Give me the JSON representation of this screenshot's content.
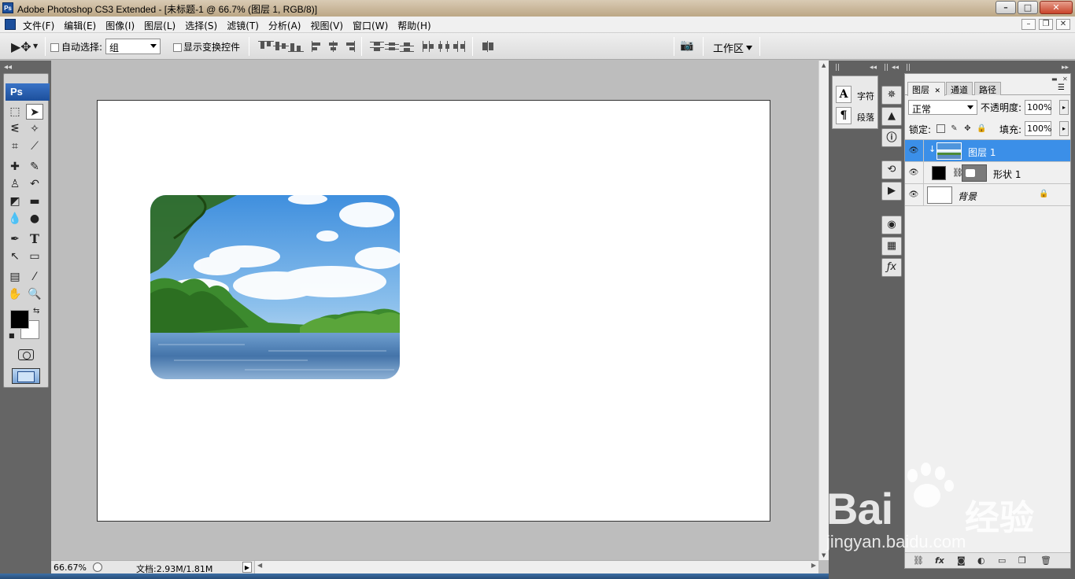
{
  "window": {
    "title": "Adobe Photoshop CS3 Extended - [未标题-1 @ 66.7% (图层 1, RGB/8)]",
    "app_badge": "Ps",
    "controls": [
      "minimize",
      "maximize",
      "close"
    ]
  },
  "menubar": {
    "items": [
      "文件(F)",
      "编辑(E)",
      "图像(I)",
      "图层(L)",
      "选择(S)",
      "滤镜(T)",
      "分析(A)",
      "视图(V)",
      "窗口(W)",
      "帮助(H)"
    ]
  },
  "options_bar": {
    "auto_select_label": "自动选择:",
    "auto_select_checked": false,
    "auto_select_value": "组",
    "show_transform_label": "显示变换控件",
    "show_transform_checked": false,
    "workspace_label": "工作区"
  },
  "toolbox": {
    "logo": "Ps",
    "foreground_color": "#000000",
    "background_color": "#ffffff",
    "tools": [
      "marquee-icon",
      "move-icon",
      "lasso-icon",
      "magic-wand-icon",
      "crop-icon",
      "slice-icon",
      "healing-brush-icon",
      "brush-icon",
      "clone-stamp-icon",
      "history-brush-icon",
      "eraser-icon",
      "gradient-icon",
      "blur-icon",
      "dodge-icon",
      "pen-icon",
      "type-icon",
      "path-select-icon",
      "shape-icon",
      "notes-icon",
      "eyedropper-icon",
      "hand-icon",
      "zoom-icon"
    ],
    "type_tool_glyph": "T"
  },
  "status_bar": {
    "zoom": "66.67%",
    "doc_info": "文档:2.93M/1.81M"
  },
  "char_panel": {
    "character_label": "字符",
    "paragraph_label": "段落",
    "character_glyph": "A",
    "paragraph_glyph": "¶"
  },
  "layers_panel": {
    "tabs": [
      "图层",
      "通道",
      "路径"
    ],
    "active_tab": "图层",
    "blend_mode": "正常",
    "opacity_label": "不透明度:",
    "opacity_value": "100%",
    "lock_label": "锁定:",
    "fill_label": "填充:",
    "fill_value": "100%",
    "layers": [
      {
        "name": "图层 1",
        "selected": true,
        "visible": true,
        "clipped": true
      },
      {
        "name": "形状 1",
        "selected": false,
        "visible": true,
        "has_mask": true
      },
      {
        "name": "背景",
        "selected": false,
        "visible": true,
        "locked": true
      }
    ],
    "bottom_buttons": [
      "link-icon",
      "fx-icon",
      "mask-icon",
      "adjustment-icon",
      "group-icon",
      "new-layer-icon",
      "trash-icon"
    ],
    "fx_label": "fx"
  },
  "watermark": {
    "brand_latin": "Bai",
    "brand_cn": "经验",
    "url": "jingyan.baidu.com"
  },
  "colors": {
    "selection_blue": "#3b8fe8",
    "ps_blue": "#1c4f9c",
    "dock_gray": "#616161",
    "canvas_bg": "#bdbdbd"
  }
}
